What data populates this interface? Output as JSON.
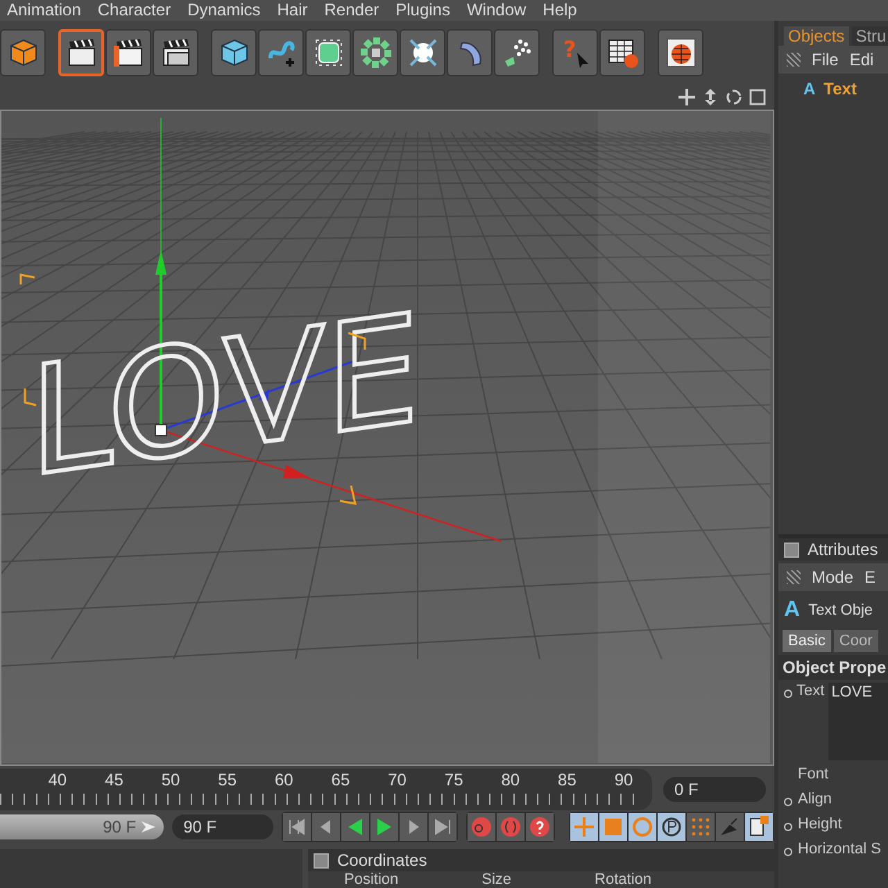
{
  "menu_bar": [
    "Animation",
    "Character",
    "Dynamics",
    "Hair",
    "Render",
    "Plugins",
    "Window",
    "Help"
  ],
  "toolbar": [
    {
      "kind": "cube-small",
      "selected": false
    },
    {
      "kind": "clapper",
      "selected": true
    },
    {
      "kind": "clapper-orange",
      "selected": false
    },
    {
      "kind": "clapper-stack",
      "selected": false
    },
    {
      "kind": "cube",
      "selected": false
    },
    {
      "kind": "spline",
      "selected": false
    },
    {
      "kind": "nurbs",
      "selected": false
    },
    {
      "kind": "array",
      "selected": false
    },
    {
      "kind": "deformer",
      "selected": false
    },
    {
      "kind": "scene",
      "selected": false
    },
    {
      "kind": "particles",
      "selected": false
    },
    {
      "kind": "help",
      "selected": false,
      "glyph": "?"
    },
    {
      "kind": "table-help",
      "selected": false
    },
    {
      "kind": "globe",
      "selected": false
    }
  ],
  "viewport": {
    "object_text": "LOVE"
  },
  "timeline": {
    "ticks": [
      "40",
      "45",
      "50",
      "55",
      "60",
      "65",
      "70",
      "75",
      "80",
      "85",
      "90"
    ],
    "current_frame": "0 F"
  },
  "transport": {
    "range_end": "90 F",
    "range_slider": {
      "level": 1
    },
    "end_field": "90 F",
    "mode_buttons": [
      {
        "kind": "move",
        "selected": true
      },
      {
        "kind": "scale",
        "selected": true
      },
      {
        "kind": "rotate",
        "selected": true
      },
      {
        "kind": "param",
        "selected": true
      },
      {
        "kind": "dots",
        "selected": false
      },
      {
        "kind": "point",
        "selected": false
      },
      {
        "kind": "doc",
        "selected": true
      }
    ]
  },
  "coordinates": {
    "title": "Coordinates",
    "columns": [
      "Position",
      "Size",
      "Rotation"
    ]
  },
  "objects": {
    "tabs": [
      {
        "label": "Objects",
        "selected": true
      },
      {
        "label": "Stru",
        "selected": false
      }
    ],
    "menu": [
      "File",
      "Edi"
    ],
    "items": [
      {
        "icon": "A",
        "label": "Text",
        "selected": true
      }
    ]
  },
  "attributes": {
    "title": "Attributes",
    "menu": [
      "Mode",
      "E"
    ],
    "object_icon": "A",
    "object_label": "Text Obje",
    "tabs": [
      {
        "label": "Basic",
        "selected": true
      },
      {
        "label": "Coor",
        "selected": false
      }
    ],
    "section": "Object Prope",
    "text_label": "Text",
    "text_value": "LOVE",
    "fields": [
      "Font",
      "Align",
      "Height",
      "Horizontal S"
    ]
  }
}
